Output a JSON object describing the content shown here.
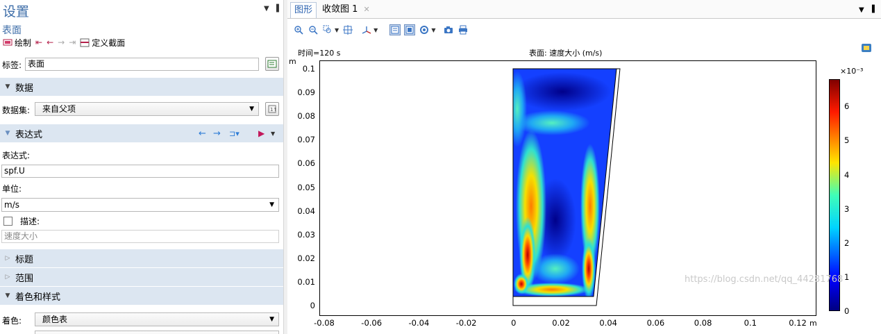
{
  "settings": {
    "title": "设置",
    "node_type": "表面",
    "toolbar": {
      "plot_label": "绘制",
      "define_cut_label": "定义截面"
    },
    "label_field": {
      "label": "标签:",
      "value": "表面"
    },
    "sections": {
      "data": "数据",
      "expression": "表达式",
      "title": "标题",
      "range": "范围",
      "coloring": "着色和样式"
    },
    "dataset": {
      "label": "数据集:",
      "value": "来自父项"
    },
    "expression": {
      "label": "表达式:",
      "value": "spf.U"
    },
    "unit": {
      "label": "单位:",
      "value": "m/s"
    },
    "description": {
      "label": "描述:",
      "checked": false,
      "value": "速度大小"
    },
    "coloring": {
      "label": "着色:",
      "value": "颜色表"
    }
  },
  "graphics": {
    "tabs": [
      "图形",
      "收敛图 1"
    ],
    "active_tab": 0,
    "plot": {
      "time_label": "时间=120 s",
      "surface_label": "表面: 速度大小 (m/s)",
      "y_unit": "m",
      "x_unit": "m",
      "y_ticks": [
        "0.1",
        "0.09",
        "0.08",
        "0.07",
        "0.06",
        "0.05",
        "0.04",
        "0.03",
        "0.02",
        "0.01",
        "0"
      ],
      "x_ticks": [
        "-0.08",
        "-0.06",
        "-0.04",
        "-0.02",
        "0",
        "0.02",
        "0.04",
        "0.06",
        "0.08",
        "0.1",
        "0.12"
      ],
      "colorbar": {
        "exponent_label": "×10⁻³",
        "ticks": [
          "6",
          "5",
          "4",
          "3",
          "2",
          "1",
          "0"
        ],
        "min": 0,
        "max": 0.0068
      }
    },
    "watermark": "https://blog.csdn.net/qq_44281768"
  },
  "colors": {
    "accent": "#3d6da8",
    "section_bg": "#dce6f1"
  }
}
